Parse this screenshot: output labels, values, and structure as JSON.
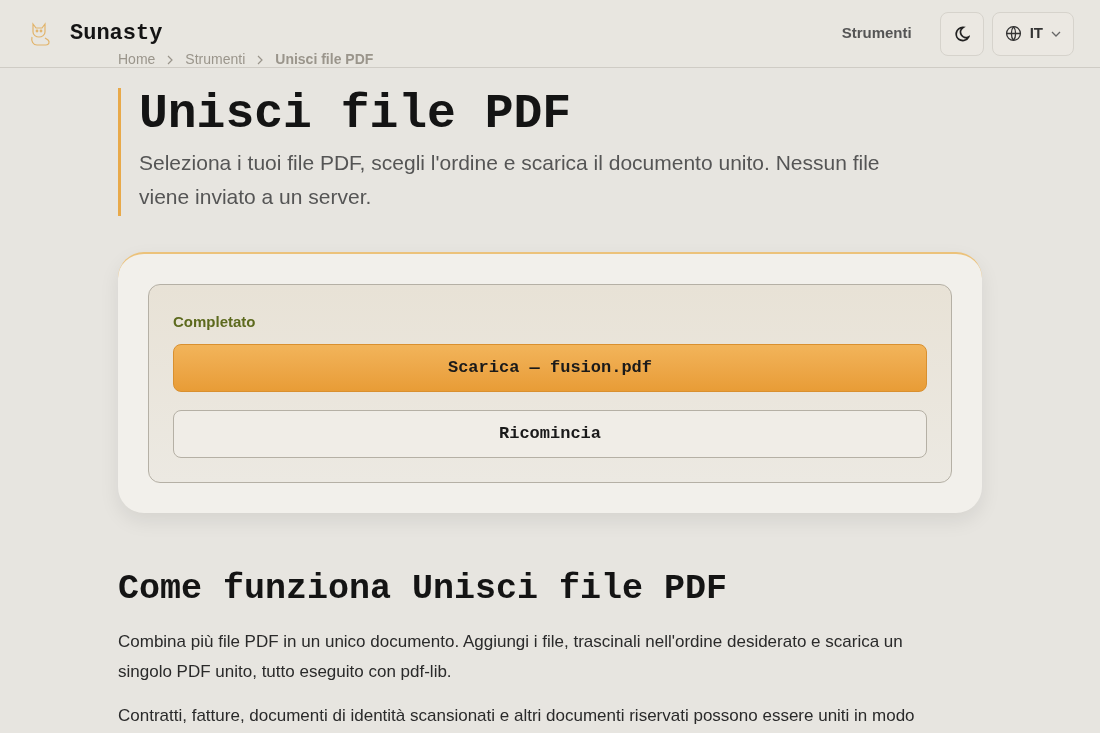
{
  "header": {
    "brand": "Sunasty",
    "nav_link": "Strumenti",
    "dark_mode": false,
    "language": "IT"
  },
  "breadcrumb": [
    "Home",
    "Strumenti",
    "Unisci file PDF"
  ],
  "hero": {
    "title": "Unisci file PDF",
    "subtitle": "Seleziona i tuoi file PDF, scegli l'ordine e scarica il documento unito. Nessun file viene inviato a un server."
  },
  "result": {
    "status": "Completato",
    "download_button": "Scarica — fusion.pdf",
    "restart_button": "Ricomincia"
  },
  "section": {
    "heading": "Come funziona Unisci file PDF",
    "paragraphs": [
      "Combina più file PDF in un unico documento. Aggiungi i file, trascinali nell'ordine desiderato e scarica un singolo PDF unito, tutto eseguito con pdf-lib.",
      "Contratti, fatture, documenti di identità scansionati e altri documenti riservati possono essere uniti in modo"
    ]
  }
}
